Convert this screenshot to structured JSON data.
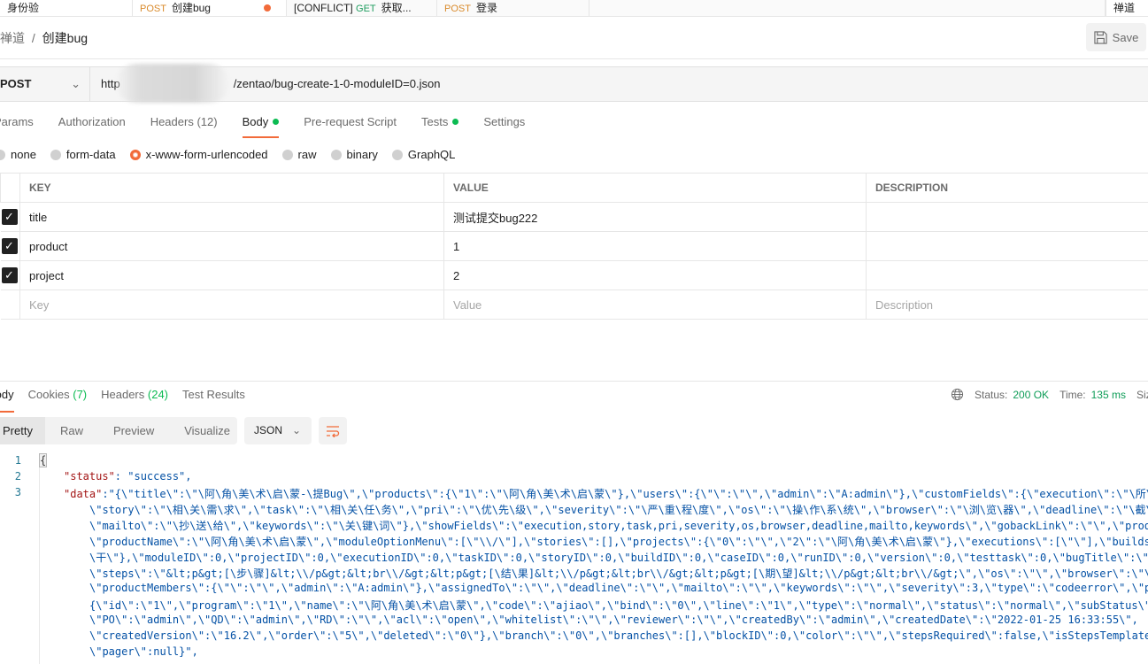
{
  "request_tabs": [
    {
      "method": "",
      "label": "身份验"
    },
    {
      "method": "POST",
      "label": "创建bug",
      "unsaved": true
    },
    {
      "method": "GET",
      "prefix": "[CONFLICT]",
      "label": "获取..."
    },
    {
      "method": "POST",
      "label": "登录"
    },
    {
      "label": "禅道"
    }
  ],
  "breadcrumb": {
    "parent": "禅道",
    "separator": "/",
    "current": "创建bug"
  },
  "save_label": "Save",
  "url_bar": {
    "method": "POST",
    "url_prefix": "http",
    "url_suffix": "/zentao/bug-create-1-0-moduleID=0.json"
  },
  "req_tabs": [
    {
      "label": "Params"
    },
    {
      "label": "Authorization"
    },
    {
      "label": "Headers",
      "count": "(12)"
    },
    {
      "label": "Body",
      "dot": true
    },
    {
      "label": "Pre-request Script"
    },
    {
      "label": "Tests",
      "dot": true
    },
    {
      "label": "Settings"
    }
  ],
  "body_types": [
    "none",
    "form-data",
    "x-www-form-urlencoded",
    "raw",
    "binary",
    "GraphQL"
  ],
  "body_selected": "x-www-form-urlencoded",
  "params_table": {
    "headers": [
      "KEY",
      "VALUE",
      "DESCRIPTION"
    ],
    "rows": [
      {
        "key": "title",
        "value": "测试提交bug222",
        "description": ""
      },
      {
        "key": "product",
        "value": "1",
        "description": ""
      },
      {
        "key": "project",
        "value": "2",
        "description": ""
      }
    ],
    "placeholder": {
      "key": "Key",
      "value": "Value",
      "description": "Description"
    }
  },
  "response_tabs": [
    {
      "label": "Body"
    },
    {
      "label": "Cookies",
      "count": "(7)"
    },
    {
      "label": "Headers",
      "count": "(24)"
    },
    {
      "label": "Test Results"
    }
  ],
  "response_status": {
    "status_label": "Status:",
    "status": "200 OK",
    "time_label": "Time:",
    "time": "135 ms",
    "size_label": "Size"
  },
  "format_tabs": [
    "Pretty",
    "Raw",
    "Preview",
    "Visualize"
  ],
  "format_lang": "JSON",
  "code": {
    "line_numbers": [
      "1",
      "2",
      "3"
    ],
    "line1": "{",
    "line2_key": "\"status\"",
    "line2_rest": ": \"success\",",
    "line3_key": "\"data\"",
    "line3_rest": ":\"{\\\"title\\\":\\\"\\阿\\角\\美\\术\\启\\蒙-\\提Bug\\\",\\\"products\\\":{\\\"1\\\":\\\"\\阿\\角\\美\\术\\启\\蒙\\\"},\\\"users\\\":{\\\"\\\":\\\"\\\",\\\"admin\\\":\\\"A:admin\\\"},\\\"customFields\\\":{\\\"execution\\\":\\\"\\所\\",
    "continuation": [
      "\\\"story\\\":\\\"\\相\\关\\需\\求\\\",\\\"task\\\":\\\"\\相\\关\\任\\务\\\",\\\"pri\\\":\\\"\\优\\先\\级\\\",\\\"severity\\\":\\\"\\严\\重\\程\\度\\\",\\\"os\\\":\\\"\\操\\作\\系\\统\\\",\\\"browser\\\":\\\"\\浏\\览\\器\\\",\\\"deadline\\\":\\\"\\截\\",
      "\\\"mailto\\\":\\\"\\抄\\送\\给\\\",\\\"keywords\\\":\\\"\\关\\键\\词\\\"},\\\"showFields\\\":\\\"execution,story,task,pri,severity,os,browser,deadline,mailto,keywords\\\",\\\"gobackLink\\\":\\\"\\\",\\\"prod",
      "\\\"productName\\\":\\\"\\阿\\角\\美\\术\\启\\蒙\\\",\\\"moduleOptionMenu\\\":[\\\"\\\\/\\\"],\\\"stories\\\":[],\\\"projects\\\":{\\\"0\\\":\\\"\\\",\\\"2\\\":\\\"\\阿\\角\\美\\术\\启\\蒙\\\"},\\\"executions\\\":[\\\"\\\"],\\\"builds",
      "\\干\\\"},\\\"moduleID\\\":0,\\\"projectID\\\":0,\\\"executionID\\\":0,\\\"taskID\\\":0,\\\"storyID\\\":0,\\\"buildID\\\":0,\\\"caseID\\\":0,\\\"runID\\\":0,\\\"version\\\":0,\\\"testtask\\\":0,\\\"bugTitle\\\":\\\"\\",
      "\\\"steps\\\":\\\"&lt;p&gt;[\\步\\骤]&lt;\\\\/p&gt;&lt;br\\\\/&gt;&lt;p&gt;[\\结\\果]&lt;\\\\/p&gt;&lt;br\\\\/&gt;&lt;p&gt;[\\期\\望]&lt;\\\\/p&gt;&lt;br\\\\/&gt;\\\",\\\"os\\\":\\\"\\\",\\\"browser\\\":\\\"\\",
      "\\\"productMembers\\\":{\\\"\\\":\\\"\\\",\\\"admin\\\":\\\"A:admin\\\"},\\\"assignedTo\\\":\\\"\\\",\\\"deadline\\\":\\\"\\\",\\\"mailto\\\":\\\"\\\",\\\"keywords\\\":\\\"\\\",\\\"severity\\\":3,\\\"type\\\":\\\"codeerror\\\",\\\"p",
      "{\\\"id\\\":\\\"1\\\",\\\"program\\\":\\\"1\\\",\\\"name\\\":\\\"\\阿\\角\\美\\术\\启\\蒙\\\",\\\"code\\\":\\\"ajiao\\\",\\\"bind\\\":\\\"0\\\",\\\"line\\\":\\\"1\\\",\\\"type\\\":\\\"normal\\\",\\\"status\\\":\\\"normal\\\",\\\"subStatus\\\"",
      "\\\"PO\\\":\\\"admin\\\",\\\"QD\\\":\\\"admin\\\",\\\"RD\\\":\\\"\\\",\\\"acl\\\":\\\"open\\\",\\\"whitelist\\\":\\\"\\\",\\\"reviewer\\\":\\\"\\\",\\\"createdBy\\\":\\\"admin\\\",\\\"createdDate\\\":\\\"2022-01-25 16:33:55\\\",",
      "\\\"createdVersion\\\":\\\"16.2\\\",\\\"order\\\":\\\"5\\\",\\\"deleted\\\":\\\"0\\\"},\\\"branch\\\":\\\"0\\\",\\\"branches\\\":[],\\\"blockID\\\":0,\\\"color\\\":\\\"\\\",\\\"stepsRequired\\\":false,\\\"isStepsTemplate",
      "\\\"pager\\\":null}\","
    ]
  },
  "colors": {
    "accent": "#f26b3a",
    "success": "#0cbb52",
    "code_string": "#0451a5",
    "code_key": "#a31515"
  }
}
